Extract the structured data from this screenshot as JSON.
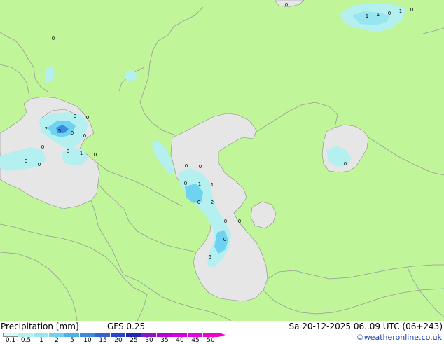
{
  "footer": {
    "title": "Precipitation [mm]",
    "model": "GFS 0.25",
    "validity": "Sa 20-12-2025 06..09 UTC (06+243)",
    "credit": "©weatheronline.co.uk"
  },
  "legend": {
    "levels": [
      "0.1",
      "0.5",
      "1",
      "2",
      "5",
      "10",
      "15",
      "20",
      "25",
      "30",
      "35",
      "40",
      "45",
      "50"
    ],
    "colors": [
      "#d2fafa",
      "#b4f0f0",
      "#96e6f0",
      "#6ed2f0",
      "#4bb4e6",
      "#3c8cdc",
      "#3264d2",
      "#2846c8",
      "#1e28b4",
      "#8c14c8",
      "#b400d2",
      "#d200dc",
      "#e600e6",
      "#f000c8"
    ]
  },
  "map": {
    "land_color": "#c0f59a",
    "water_color": "#e6e6e6",
    "border_color": "#999999",
    "point_labels": [
      "0",
      "0",
      "0",
      "1",
      "1",
      "0",
      "1",
      "0",
      "0",
      "0",
      "0",
      "0",
      "2",
      "5",
      "0",
      "0",
      "0",
      "0",
      "1",
      "0",
      "0",
      "0",
      "0",
      "0",
      "0",
      "1",
      "1",
      "0",
      "2",
      "0",
      "0",
      "0",
      "5",
      "0",
      "0"
    ]
  }
}
